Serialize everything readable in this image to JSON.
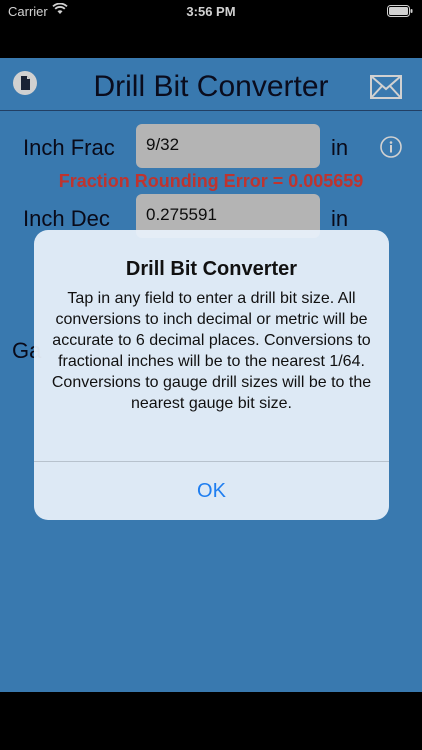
{
  "status_bar": {
    "carrier": "Carrier",
    "time": "3:56 PM"
  },
  "header": {
    "title": "Drill Bit Converter",
    "left_icon": "document-icon",
    "right_icon": "mail-icon"
  },
  "rows": {
    "inch_frac": {
      "label": "Inch Frac",
      "value": "9/32",
      "unit": "in"
    },
    "inch_dec": {
      "label": "Inch Dec",
      "value": "0.275591",
      "unit": "in"
    },
    "partial_gauge_label": "Ga"
  },
  "error_text": "Fraction Rounding Error = 0.005659",
  "alert": {
    "title": "Drill Bit Converter",
    "message": "Tap in any field to enter a drill bit size. All conversions to inch decimal or metric will be accurate to 6 decimal places. Conversions to fractional inches will be to the nearest 1/64. Conversions to gauge drill sizes will be to the nearest gauge bit size.",
    "ok_label": "OK"
  },
  "colors": {
    "background": "#4694d6",
    "error": "#e8403a",
    "link": "#1f7ef0"
  }
}
